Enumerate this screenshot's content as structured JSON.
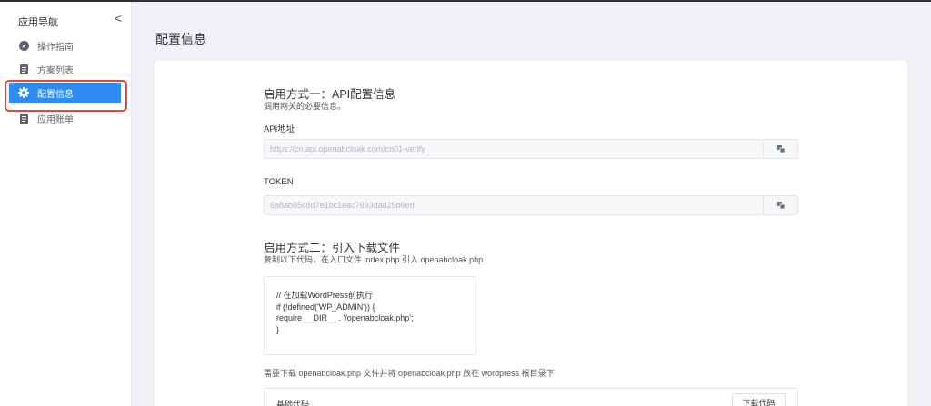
{
  "sidebar": {
    "heading": "应用导航",
    "collapse_glyph": "<",
    "items": [
      {
        "label": "操作指南",
        "icon": "compass-icon"
      },
      {
        "label": "方案列表",
        "icon": "document-icon"
      },
      {
        "label": "配置信息",
        "icon": "gear-icon"
      },
      {
        "label": "应用账单",
        "icon": "document-icon"
      }
    ]
  },
  "page": {
    "title": "配置信息"
  },
  "section1": {
    "title": "启用方式一：API配置信息",
    "desc": "调用网关的必要信息。",
    "api_label": "API地址",
    "api_value": "https://cn.api.openabcloak.com/cn01-verify",
    "token_label": "TOKEN",
    "token_value": "6a8ab85c8d7e1bc1eac7693dad25b6ed"
  },
  "section2": {
    "title": "启用方式二：引入下载文件",
    "desc": "复制以下代码，在入口文件 index.php 引入 openabcloak.php",
    "code": [
      "// 在加载WordPress前执行",
      "if (!defined('WP_ADMIN')) {",
      "require __DIR__ . '/openabcloak.php';",
      "}"
    ],
    "note": "需要下载 openabcloak.php 文件并将 openabcloak.php 放在 wordpress 根目录下",
    "base_code_label": "基础代码",
    "download_label": "下载代码"
  },
  "colors": {
    "accent": "#2d8cf0",
    "highlight": "#e2483d"
  }
}
